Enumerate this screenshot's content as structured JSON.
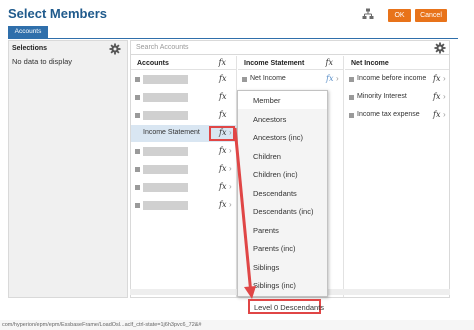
{
  "header": {
    "title": "Select Members",
    "ok_label": "OK",
    "cancel_label": "Cancel"
  },
  "dimension_tab": "Accounts",
  "selections": {
    "title": "Selections",
    "empty_text": "No data to display"
  },
  "search": {
    "placeholder": "Search Accounts"
  },
  "columns": {
    "col1": {
      "header": "Accounts",
      "selected_item": "Income Statement"
    },
    "col2": {
      "header": "Income Statement",
      "first_item": "Net Income"
    },
    "col3": {
      "header": "Net Income",
      "items": [
        "Income before income",
        "Minority Interest",
        "Income tax expense"
      ]
    }
  },
  "function_menu": {
    "items": [
      "Member",
      "Ancestors",
      "Ancestors (inc)",
      "Children",
      "Children (inc)",
      "Descendants",
      "Descendants (inc)",
      "Parents",
      "Parents (inc)",
      "Siblings",
      "Siblings (inc)"
    ],
    "highlighted": "Level 0 Descendants"
  },
  "icons": {
    "fx": "fx",
    "chevron": "›",
    "hierarchy": "hierarchy-icon",
    "gear": "gear-icon"
  },
  "colors": {
    "title": "#1f5a8c",
    "button": "#e8731a",
    "tab": "#2f6fab",
    "annotation": "#e04646"
  },
  "status_bar": {
    "text": "com/hyperion/epm/epm/EssbaseFrame/LoadOsl...aclf_ctrl-state=1j6h3pvc6_72&#"
  }
}
